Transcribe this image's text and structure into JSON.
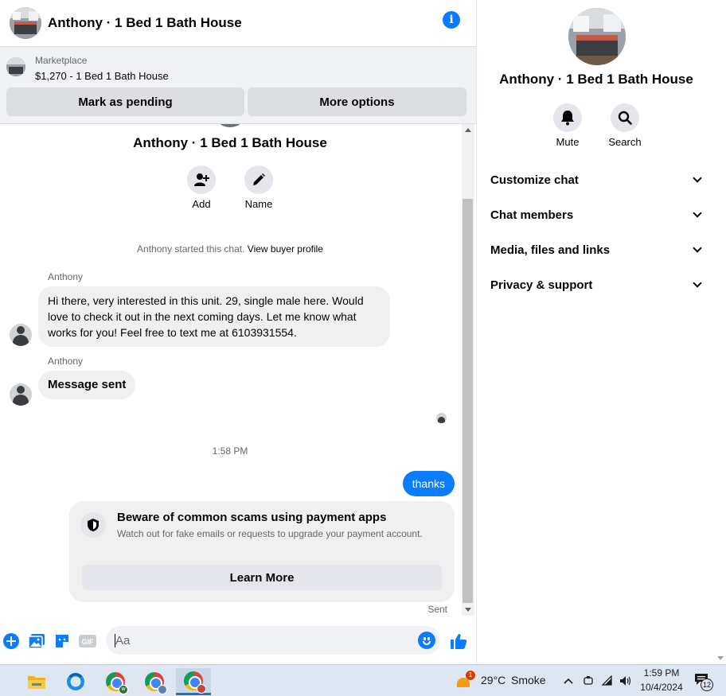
{
  "header": {
    "title": "Anthony · 1 Bed 1 Bath House"
  },
  "marketplace": {
    "label": "Marketplace",
    "listing": "$1,270 - 1 Bed 1 Bath House",
    "pending_button": "Mark as pending",
    "options_button": "More options"
  },
  "thread": {
    "title": "Anthony · 1 Bed 1 Bath House",
    "add_label": "Add",
    "name_label": "Name",
    "started_text": "Anthony started this chat.",
    "view_profile": "View buyer profile",
    "messages": [
      {
        "sender": "Anthony",
        "text": "Hi there, very interested in this unit. 29, single male here. Would love to check it out in the next coming days. Let me know what works for you! Feel free to text me at 6103931554."
      },
      {
        "sender": "Anthony",
        "text": "Message sent"
      }
    ],
    "timestamp": "1:58 PM",
    "outgoing": "thanks",
    "scam_card": {
      "title": "Beware of common scams using payment apps",
      "body": "Watch out for fake emails or requests to upgrade your payment account.",
      "button": "Learn More"
    },
    "status": "Sent"
  },
  "composer": {
    "placeholder": "Aa",
    "gif_label": "GIF"
  },
  "details": {
    "title": "Anthony · 1 Bed 1 Bath House",
    "mute_label": "Mute",
    "search_label": "Search",
    "sections": [
      "Customize chat",
      "Chat members",
      "Media, files and links",
      "Privacy & support"
    ]
  },
  "taskbar": {
    "weather_badge": "1",
    "temperature": "29°C",
    "condition": "Smoke",
    "time": "1:59 PM",
    "date": "10/4/2024",
    "notification_count": "12"
  },
  "colors": {
    "accent": "#0a7cff",
    "bubble_in": "#f0f0f0",
    "panel": "#f0f2f5"
  }
}
